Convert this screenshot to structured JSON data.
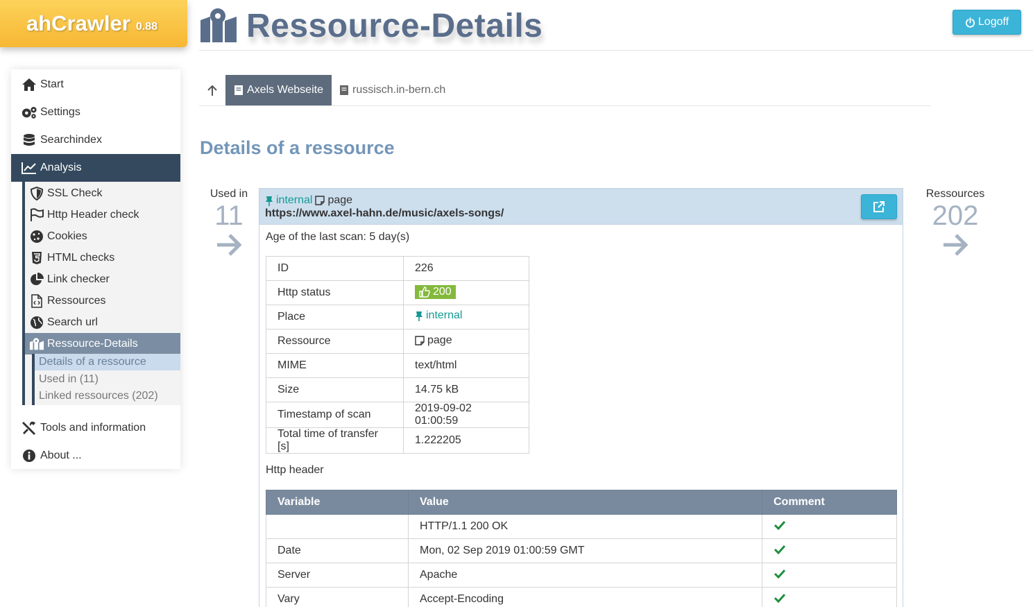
{
  "app": {
    "name": "ahCrawler",
    "version": "0.88"
  },
  "page_title": "Ressource-Details",
  "logoff_label": "Logoff",
  "sidebar": {
    "items": [
      {
        "label": "Start",
        "icon": "home-icon"
      },
      {
        "label": "Settings",
        "icon": "gears-icon"
      },
      {
        "label": "Searchindex",
        "icon": "database-icon"
      },
      {
        "label": "Analysis",
        "icon": "chart-icon"
      }
    ],
    "analysis_sub": [
      {
        "label": "SSL Check",
        "icon": "shield-icon"
      },
      {
        "label": "Http Header check",
        "icon": "flag-icon"
      },
      {
        "label": "Cookies",
        "icon": "cookie-icon"
      },
      {
        "label": "HTML checks",
        "icon": "html5-icon"
      },
      {
        "label": "Link checker",
        "icon": "pie-chart-icon"
      },
      {
        "label": "Ressources",
        "icon": "file-code-icon"
      },
      {
        "label": "Search url",
        "icon": "globe-icon"
      },
      {
        "label": "Ressource-Details",
        "icon": "map-icon"
      }
    ],
    "details_sub": [
      {
        "label": "Details of a ressource"
      },
      {
        "label": "Used in (11)"
      },
      {
        "label": "Linked ressources (202)"
      }
    ],
    "bottom_items": [
      {
        "label": "Tools and information",
        "icon": "tools-icon"
      },
      {
        "label": "About ...",
        "icon": "info-icon"
      }
    ]
  },
  "tabs": [
    {
      "label": "Axels Webseite",
      "active": true
    },
    {
      "label": "russisch.in-bern.ch",
      "active": false
    }
  ],
  "section_title": "Details of a ressource",
  "used_in": {
    "label": "Used in",
    "count": "11"
  },
  "ressources": {
    "label": "Ressources",
    "count": "202"
  },
  "resource": {
    "place": "internal",
    "type": "page",
    "url": "https://www.axel-hahn.de/music/axels-songs/",
    "age": "Age of the last scan: 5 day(s)"
  },
  "details": {
    "id_label": "ID",
    "id": "226",
    "status_label": "Http status",
    "status": "200",
    "place_label": "Place",
    "place": "internal",
    "ressource_label": "Ressource",
    "ressource": "page",
    "mime_label": "MIME",
    "mime": "text/html",
    "size_label": "Size",
    "size": "14.75 kB",
    "ts_label": "Timestamp of scan",
    "ts": "2019-09-02 01:00:59",
    "ttime_label": "Total time of transfer [s]",
    "ttime": "1.222205"
  },
  "http_header": {
    "label": "Http header",
    "columns": [
      "Variable",
      "Value",
      "Comment"
    ],
    "rows": [
      {
        "variable": "",
        "value": "HTTP/1.1 200 OK"
      },
      {
        "variable": "Date",
        "value": "Mon, 02 Sep 2019 01:00:59 GMT"
      },
      {
        "variable": "Server",
        "value": "Apache"
      },
      {
        "variable": "Vary",
        "value": "Accept-Encoding"
      }
    ]
  },
  "colors": {
    "accent": "#3bb4d8",
    "nav_active": "#34495e",
    "title": "#5a6e8c",
    "ok_green": "#1e8e3e",
    "badge_green": "#84b93c",
    "internal_teal": "#139a93"
  }
}
